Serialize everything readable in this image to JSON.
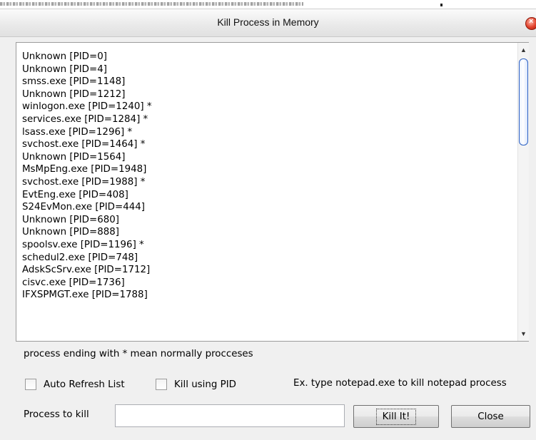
{
  "window": {
    "title": "Kill Process in Memory"
  },
  "process_list": [
    "Unknown [PID=0]",
    "Unknown [PID=4]",
    "smss.exe [PID=1148]",
    "Unknown [PID=1212]",
    "winlogon.exe [PID=1240] *",
    "services.exe [PID=1284] *",
    "lsass.exe [PID=1296] *",
    "svchost.exe [PID=1464] *",
    "Unknown [PID=1564]",
    "MsMpEng.exe [PID=1948]",
    "svchost.exe [PID=1988] *",
    "EvtEng.exe [PID=408]",
    "S24EvMon.exe [PID=444]",
    "Unknown [PID=680]",
    "Unknown [PID=888]",
    "spoolsv.exe [PID=1196] *",
    "schedul2.exe [PID=748]",
    "AdskScSrv.exe [PID=1712]",
    "cisvc.exe [PID=1736]",
    "IFXSPMGT.exe [PID=1788]"
  ],
  "hint": "process ending with * mean normally procceses",
  "options": {
    "auto_refresh_label": "Auto Refresh List",
    "auto_refresh_checked": false,
    "kill_pid_label": "Kill using PID",
    "kill_pid_checked": false
  },
  "example_text": "Ex. type notepad.exe to kill notepad process",
  "process_field": {
    "label": "Process to kill",
    "value": ""
  },
  "buttons": {
    "kill": "Kill It!",
    "close": "Close"
  },
  "colors": {
    "close_button": "#e0402a",
    "scroll_thumb_border": "#2e62c4"
  }
}
